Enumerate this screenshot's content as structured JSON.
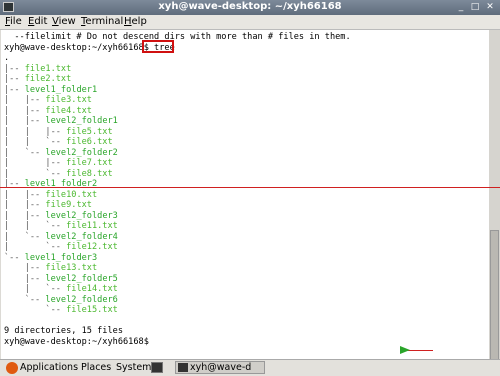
{
  "window": {
    "title": "xyh@wave-desktop: ~/xyh66168"
  },
  "menu": [
    {
      "label": "File",
      "u": "F"
    },
    {
      "label": "Edit",
      "u": "E"
    },
    {
      "label": "View",
      "u": "V"
    },
    {
      "label": "Terminal",
      "u": "T"
    },
    {
      "label": "Help",
      "u": "H"
    }
  ],
  "terminal": {
    "lines": [
      "  --filelimit # Do not descend dirs with more than # files in them.",
      "xyh@wave-desktop:~/xyh66168$ tree",
      ".",
      "|-- file1.txt",
      "|-- file2.txt",
      "|-- level1_folder1",
      "|   |-- file3.txt",
      "|   |-- file4.txt",
      "|   |-- level2_folder1",
      "|   |   |-- file5.txt",
      "|   |   `-- file6.txt",
      "|   `-- level2_folder2",
      "|       |-- file7.txt",
      "|       `-- file8.txt",
      "|-- level1_folder2",
      "|   |-- file10.txt",
      "|   |-- file9.txt",
      "|   |-- level2_folder3",
      "|   |   `-- file11.txt",
      "|   `-- level2_folder4",
      "|       `-- file12.txt",
      "`-- level1_folder3",
      "    |-- file13.txt",
      "    |-- level2_folder5",
      "    |   `-- file14.txt",
      "    `-- level2_folder6",
      "        `-- file15.txt",
      "",
      "9 directories, 15 files",
      "xyh@wave-desktop:~/xyh66168$"
    ]
  },
  "panel": {
    "applications": "Applications",
    "places": "Places",
    "system": "System",
    "task": "xyh@wave-d"
  },
  "colors": {
    "accent_red": "#d02020",
    "name_green": "#4bb82f",
    "arrow_green": "#2aa52a"
  }
}
